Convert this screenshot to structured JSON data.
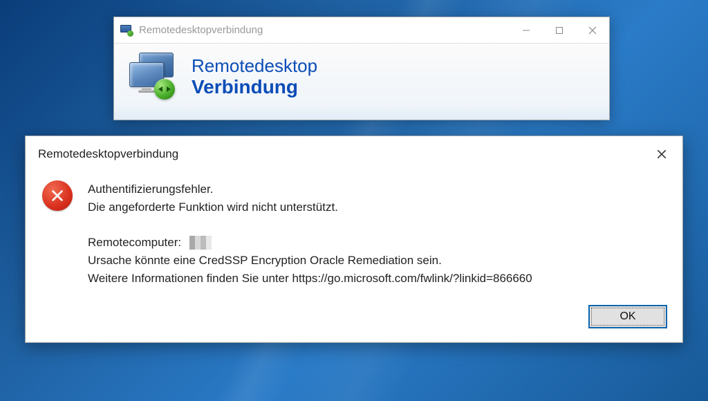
{
  "parent_window": {
    "title": "Remotedesktopverbindung",
    "banner_line1": "Remotedesktop",
    "banner_line2": "Verbindung"
  },
  "error_dialog": {
    "title": "Remotedesktopverbindung",
    "message": {
      "line1": "Authentifizierungsfehler.",
      "line2": "Die angeforderte Funktion wird nicht unterstützt.",
      "remote_label": "Remotecomputer:",
      "cause": "Ursache könnte eine CredSSP Encryption Oracle Remediation sein.",
      "info": "Weitere Informationen finden Sie unter https://go.microsoft.com/fwlink/?linkid=866660"
    },
    "ok_label": "OK"
  }
}
